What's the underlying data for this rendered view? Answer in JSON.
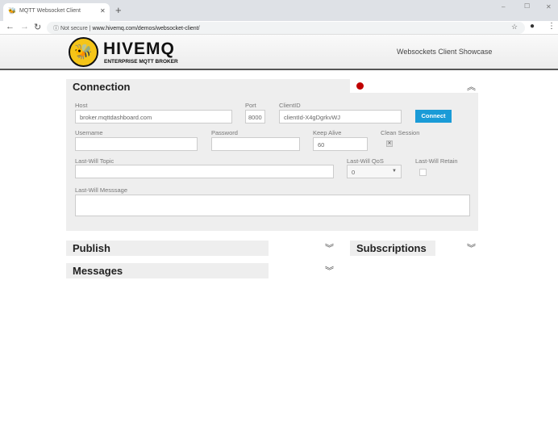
{
  "browser": {
    "tab_title": "MQTT Websocket Client",
    "new_tab": "+",
    "security": "Not secure",
    "url": "www.hivemq.com/demos/websocket-client/",
    "window_controls": [
      "–",
      "☐",
      "✕"
    ]
  },
  "header": {
    "logo_title": "HIVEMQ",
    "logo_subtitle": "ENTERPRISE MQTT BROKER",
    "showcase": "Websockets Client Showcase"
  },
  "connection": {
    "title": "Connection",
    "status_color": "#c00000",
    "host_label": "Host",
    "host": "broker.mqttdashboard.com",
    "port_label": "Port",
    "port": "8000",
    "clientid_label": "ClientID",
    "clientid": "clientId-X4gDgrkvWJ",
    "connect": "Connect",
    "username_label": "Username",
    "password_label": "Password",
    "keepalive_label": "Keep Alive",
    "keepalive": "60",
    "clean_label": "Clean Session",
    "clean_mark": "✕",
    "lwtopic_label": "Last-Will Topic",
    "lwqos_label": "Last-Will QoS",
    "lwqos": "0",
    "lwretain_label": "Last-Will Retain",
    "lwmsg_label": "Last-Will Messsage"
  },
  "publish": {
    "title": "Publish"
  },
  "subscriptions": {
    "title": "Subscriptions"
  },
  "messages": {
    "title": "Messages"
  },
  "colors": {
    "accent": "#1a9bd7"
  }
}
